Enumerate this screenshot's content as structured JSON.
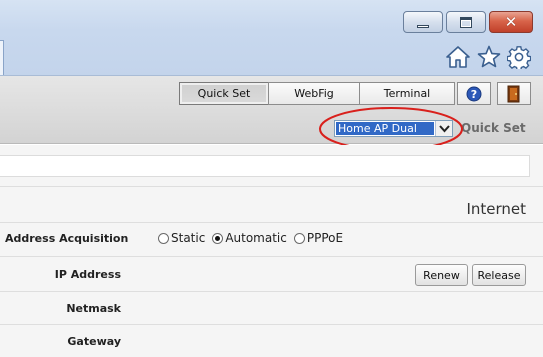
{
  "window": {
    "minimize_icon": "minimize-icon",
    "maximize_icon": "maximize-icon",
    "close_icon": "close-icon",
    "close_glyph": "✕"
  },
  "browser": {
    "icons": [
      "home-icon",
      "star-icon",
      "gear-icon"
    ]
  },
  "toolbar": {
    "tabs": [
      {
        "label": "Quick Set",
        "active": true
      },
      {
        "label": "WebFig",
        "active": false
      },
      {
        "label": "Terminal",
        "active": false
      }
    ],
    "help_icon": "help-icon",
    "logout_icon": "logout-door-icon"
  },
  "quickset": {
    "mode_value": "Home AP Dual",
    "title": "Quick Set",
    "highlight_color": "#d9201c",
    "selected_bg": "#3169c6"
  },
  "internet": {
    "section_title": "Internet",
    "address_acquisition_label": "Address Acquisition",
    "options": [
      "Static",
      "Automatic",
      "PPPoE"
    ],
    "selected_option": "Automatic",
    "ip_address_label": "IP Address",
    "renew_label": "Renew",
    "release_label": "Release",
    "netmask_label": "Netmask",
    "gateway_label": "Gateway"
  }
}
